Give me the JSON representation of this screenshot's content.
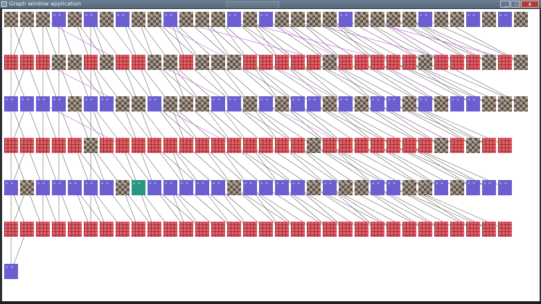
{
  "window": {
    "title": "Graph window application",
    "buttons": {
      "minimize": "_",
      "maximize": "□",
      "close": "x"
    }
  },
  "graph": {
    "rows": [
      [
        "brown",
        "brown",
        "brown",
        "purple",
        "brown",
        "purple",
        "brown",
        "purple",
        "brown",
        "brown",
        "purple",
        "brown",
        "brown",
        "brown",
        "purple",
        "brown",
        "purple",
        "brown",
        "brown",
        "brown",
        "brown",
        "purple",
        "brown",
        "brown",
        "brown",
        "brown",
        "purple",
        "brown",
        "brown",
        "purple",
        "brown",
        "purple",
        "brown"
      ],
      [
        "red",
        "red",
        "red",
        "brown",
        "brown",
        "red",
        "brown",
        "red",
        "red",
        "brown",
        "brown",
        "red",
        "brown",
        "brown",
        "brown",
        "red",
        "red",
        "red",
        "red",
        "red",
        "brown",
        "red",
        "red",
        "red",
        "red",
        "red",
        "brown",
        "red",
        "red",
        "red",
        "brown",
        "red",
        "brown"
      ],
      [
        "purple",
        "purple",
        "purple",
        "purple",
        "brown",
        "purple",
        "purple",
        "brown",
        "brown",
        "purple",
        "brown",
        "brown",
        "brown",
        "purple",
        "purple",
        "brown",
        "purple",
        "brown",
        "purple",
        "purple",
        "brown",
        "purple",
        "brown",
        "purple",
        "purple",
        "brown",
        "purple",
        "brown",
        "purple",
        "purple",
        "brown",
        "brown",
        "brown"
      ],
      [
        "red",
        "red",
        "red",
        "red",
        "red",
        "brown",
        "red",
        "red",
        "red",
        "red",
        "red",
        "red",
        "red",
        "red",
        "red",
        "red",
        "red",
        "red",
        "red",
        "brown",
        "red",
        "red",
        "red",
        "red",
        "red",
        "red",
        "red",
        "brown",
        "red",
        "brown",
        "red",
        "red"
      ],
      [
        "purple",
        "brown",
        "purple",
        "purple",
        "purple",
        "purple",
        "purple",
        "brown",
        "teal",
        "purple",
        "purple",
        "purple",
        "purple",
        "purple",
        "brown",
        "purple",
        "purple",
        "purple",
        "purple",
        "brown",
        "purple",
        "brown",
        "brown",
        "purple",
        "purple",
        "brown",
        "brown",
        "purple",
        "brown",
        "purple",
        "purple",
        "purple"
      ],
      [
        "red",
        "red",
        "red",
        "red",
        "red",
        "red",
        "red",
        "red",
        "red",
        "red",
        "red",
        "red",
        "red",
        "red",
        "red",
        "red",
        "red",
        "red",
        "red",
        "red",
        "red",
        "red",
        "red",
        "red",
        "red",
        "red",
        "red",
        "red",
        "red",
        "red",
        "red",
        "red"
      ],
      [
        "purple"
      ]
    ]
  }
}
